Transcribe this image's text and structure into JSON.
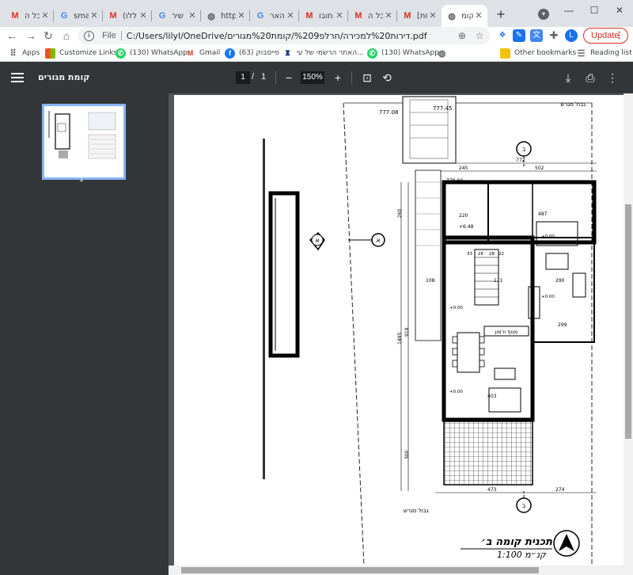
{
  "tabs": [
    {
      "title": "כל ה",
      "favicon": "gmail-icon",
      "active": false
    },
    {
      "title": "sma",
      "favicon": "google-icon",
      "active": false
    },
    {
      "title": "(ללו",
      "favicon": "gmail-icon",
      "active": false
    },
    {
      "title": "שיר",
      "favicon": "google-icon",
      "active": false
    },
    {
      "title": "http",
      "favicon": "globe-icon",
      "active": false
    },
    {
      "title": "האר",
      "favicon": "google-icon",
      "active": false
    },
    {
      "title": "חובו",
      "favicon": "gmail-icon",
      "active": false
    },
    {
      "title": "כל ה",
      "favicon": "gmail-icon",
      "active": false
    },
    {
      "title": "[חת",
      "favicon": "gmail-icon",
      "active": false
    },
    {
      "title": "קומ",
      "favicon": "globe-icon",
      "active": true
    }
  ],
  "toolbar": {
    "scheme": "File",
    "url": "C:/Users/lilyl/OneDrive/דירות%20למכירה/חרלפ%209/קומת%20מגורים.pdf",
    "update_label": "Update"
  },
  "bookmarks": {
    "items": [
      {
        "label": "Apps",
        "icon": "apps-icon"
      },
      {
        "label": "Customize Links",
        "icon": "windows-icon"
      },
      {
        "label": "(130) WhatsApp",
        "icon": "whatsapp-icon"
      },
      {
        "label": "Gmail",
        "icon": "gmail-icon"
      },
      {
        "label": "(63) פייסבוק",
        "icon": "facebook-icon"
      },
      {
        "label": "האתר הרשמי של עי...",
        "icon": "site-icon"
      },
      {
        "label": "(130) WhatsApp",
        "icon": "whatsapp-icon"
      },
      {
        "label": "",
        "icon": "globe-icon"
      }
    ],
    "other": "Other bookmarks",
    "reading": "Reading list"
  },
  "pdf": {
    "title": "קומת מגורים",
    "current_page": "1",
    "separator": "/",
    "total_pages": "1",
    "zoom": "150%",
    "thumb_number": "1"
  },
  "plan": {
    "elevations": [
      "777.08",
      "777.45",
      "779.60",
      "+6.48",
      "+0.00",
      "+0.00",
      "+0.00",
      "+0.00"
    ],
    "section_marks": [
      "א",
      "א",
      "ב",
      "ב"
    ],
    "dims": [
      "772",
      "245",
      "502",
      "220",
      "487",
      "108",
      "111",
      "290",
      "299",
      "403",
      "473",
      "274",
      "260",
      "1495",
      "918",
      "300",
      "33",
      "26",
      "28",
      "22"
    ],
    "room_label": "מגוף ורמון",
    "boundary_top": "גבול מגרש",
    "boundary_bottom": "גבול מגרש",
    "plan_title": "תכנית קומה ב׳",
    "plan_scale": "קנ״מ 1:100"
  },
  "colors": {
    "pdf_bar": "#323639",
    "viewer_bg": "#525659",
    "update_red": "#d93025",
    "thumb_border": "#8ab4f8"
  }
}
